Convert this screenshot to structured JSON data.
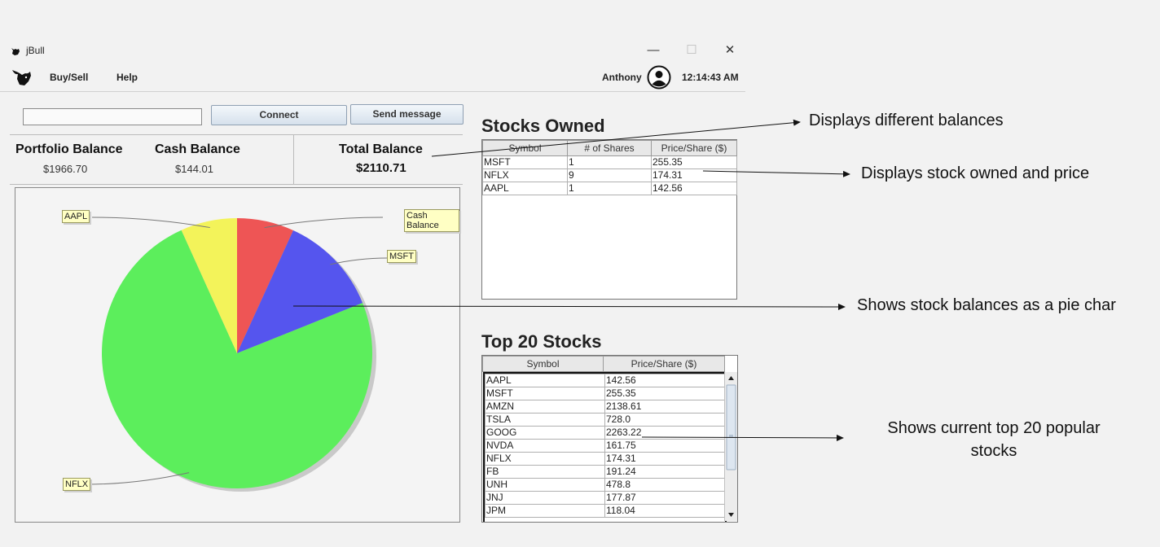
{
  "window": {
    "title": "jBull",
    "minimize": "—",
    "maximize": "☐",
    "close": "✕"
  },
  "menu": {
    "buy_sell": "Buy/Sell",
    "help": "Help",
    "user": "Anthony",
    "time": "12:14:43 AM"
  },
  "connect": {
    "input_value": "",
    "connect_label": "Connect",
    "send_label": "Send message"
  },
  "balances": {
    "portfolio_label": "Portfolio Balance",
    "portfolio_value": "$1966.70",
    "cash_label": "Cash Balance",
    "cash_value": "$144.01",
    "total_label": "Total Balance",
    "total_value": "$2110.71"
  },
  "chart_data": {
    "type": "pie",
    "slices": [
      {
        "label": "Cash Balance",
        "value": 144.01,
        "color": "#ee5555"
      },
      {
        "label": "MSFT",
        "value": 255.35,
        "color": "#5555ee"
      },
      {
        "label": "NFLX",
        "value": 1568.79,
        "color": "#5cee5c"
      },
      {
        "label": "AAPL",
        "value": 142.56,
        "color": "#f3f35a"
      }
    ]
  },
  "stocks_owned": {
    "title": "Stocks Owned",
    "headers": [
      "Symbol",
      "# of Shares",
      "Price/Share ($)"
    ],
    "rows": [
      [
        "MSFT",
        "1",
        "255.35"
      ],
      [
        "NFLX",
        "9",
        "174.31"
      ],
      [
        "AAPL",
        "1",
        "142.56"
      ]
    ]
  },
  "top_stocks": {
    "title": "Top 20 Stocks",
    "headers": [
      "Symbol",
      "Price/Share ($)"
    ],
    "rows": [
      [
        "AAPL",
        "142.56"
      ],
      [
        "MSFT",
        "255.35"
      ],
      [
        "AMZN",
        "2138.61"
      ],
      [
        "TSLA",
        "728.0"
      ],
      [
        "GOOG",
        "2263.22"
      ],
      [
        "NVDA",
        "161.75"
      ],
      [
        "NFLX",
        "174.31"
      ],
      [
        "FB",
        "191.24"
      ],
      [
        "UNH",
        "478.8"
      ],
      [
        "JNJ",
        "177.87"
      ],
      [
        "JPM",
        "118.04"
      ]
    ]
  },
  "annotations": {
    "balances": "Displays different balances",
    "owned": "Displays stock owned and price",
    "pie": "Shows stock balances as a pie char",
    "top_line1": "Shows current top 20 popular",
    "top_line2": "stocks"
  }
}
